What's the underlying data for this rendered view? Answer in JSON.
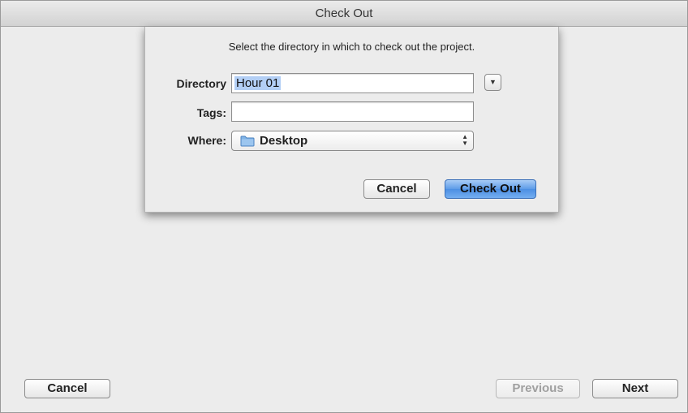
{
  "window": {
    "title": "Check Out"
  },
  "sheet": {
    "message": "Select the directory in which to check out the project.",
    "directory": {
      "label": "Directory",
      "value": "Hour 01"
    },
    "tags": {
      "label": "Tags:",
      "value": ""
    },
    "where": {
      "label": "Where:",
      "selected": "Desktop",
      "icon": "folder-icon"
    },
    "buttons": {
      "cancel": "Cancel",
      "check_out": "Check Out"
    }
  },
  "footer": {
    "cancel": "Cancel",
    "previous": "Previous",
    "next": "Next"
  }
}
